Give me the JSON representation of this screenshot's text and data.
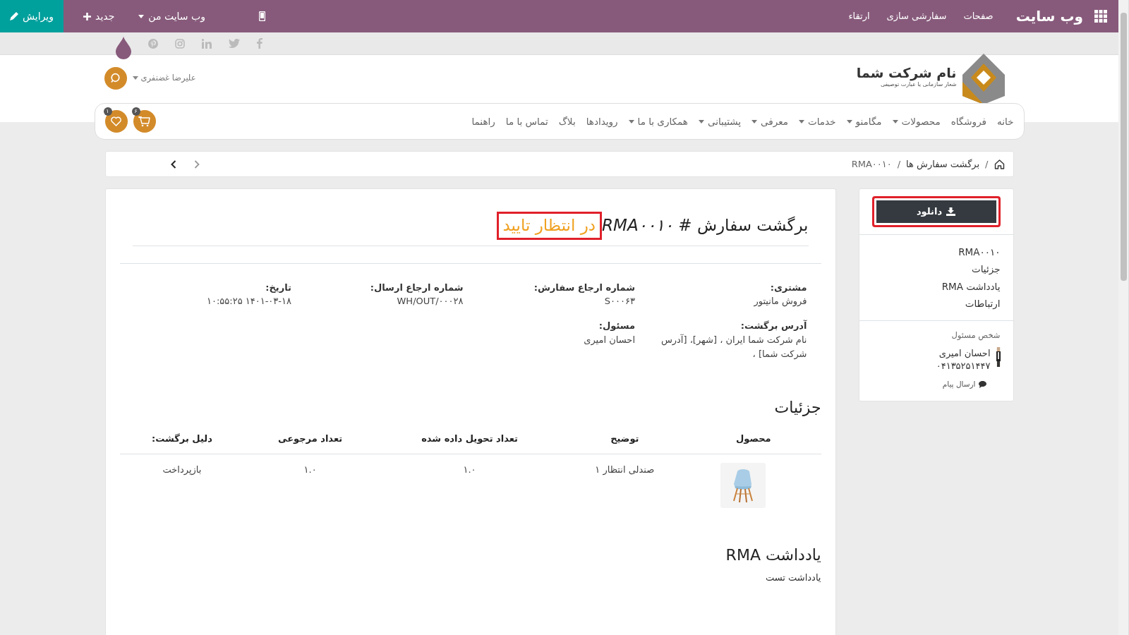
{
  "topbar": {
    "app_title": "وب سایت",
    "menu": [
      "صفحات",
      "سفارشی سازی",
      "ارتقاء"
    ],
    "website_menu": "وب سایت من",
    "new_button": "جدید",
    "edit_button": "ویرایش"
  },
  "header": {
    "company_name": "نام شرکت شما",
    "tagline": "شعار سازمانی یا عبارت توصیفی",
    "user": "علیرضا غضنفری"
  },
  "nav": [
    {
      "label": "خانه",
      "dropdown": false
    },
    {
      "label": "فروشگاه",
      "dropdown": false
    },
    {
      "label": "محصولات",
      "dropdown": true
    },
    {
      "label": "مگامنو",
      "dropdown": true
    },
    {
      "label": "خدمات",
      "dropdown": true
    },
    {
      "label": "معرفی",
      "dropdown": true
    },
    {
      "label": "پشتیبانی",
      "dropdown": true
    },
    {
      "label": "همکاری با ما",
      "dropdown": true
    },
    {
      "label": "رویدادها",
      "dropdown": false
    },
    {
      "label": "بلاگ",
      "dropdown": false
    },
    {
      "label": "تماس با ما",
      "dropdown": false
    },
    {
      "label": "راهنما",
      "dropdown": false
    }
  ],
  "cart_count": "۶",
  "wishlist_count": "۱",
  "breadcrumb": [
    {
      "separator": "/",
      "label": "برگشت سفارش ها"
    },
    {
      "separator": "/",
      "label": "RMA۰۰۱۰"
    }
  ],
  "sidebar": {
    "download": {
      "label": "دانلود",
      "highlighted": true
    },
    "links": [
      "RMA۰۰۱۰",
      "جزئیات",
      "یادداشت RMA",
      "ارتباطات"
    ],
    "contact_heading": "شخص مسئول",
    "contact_name": "احسان امیری",
    "contact_phone": "۰۴۱۳۵۲۵۱۴۴۷",
    "message_link": "ارسال پیام"
  },
  "document": {
    "title_prefix": "برگشت سفارش # ",
    "reference": "RMA۰۰۱۰",
    "status": {
      "label": "در انتظار تایید",
      "highlighted": true
    },
    "fields": [
      {
        "label": "مشتری:",
        "value": "فروش مانیتور"
      },
      {
        "label": "شماره ارجاع سفارش:",
        "value": "S۰۰۰۶۳"
      },
      {
        "label": "شماره ارجاع ارسال:",
        "value": "WH/OUT/۰۰۰۲۸"
      },
      {
        "label": "تاریخ:",
        "value": "۱۴۰۱-۰۳-۱۸ ۱۰:۵۵:۲۵"
      },
      {
        "label": "آدرس برگشت:",
        "value": "نام شرکت شما ایران ، [شهر]، [آدرس شرکت شما] ،"
      },
      {
        "label": "مسئول:",
        "value": "احسان امیری"
      }
    ],
    "details_heading": "جزئیات",
    "table": {
      "columns": [
        "محصول",
        "توضیح",
        "تعداد تحویل داده شده",
        "تعداد مرجوعی",
        "دلیل برگشت:"
      ],
      "rows": [
        {
          "description": "صندلی انتظار ۱",
          "delivered": "۱.۰",
          "returned": "۱.۰",
          "reason": "بازپرداخت"
        }
      ]
    },
    "note_heading": "یادداشت RMA",
    "note": "یادداشت تست"
  }
}
